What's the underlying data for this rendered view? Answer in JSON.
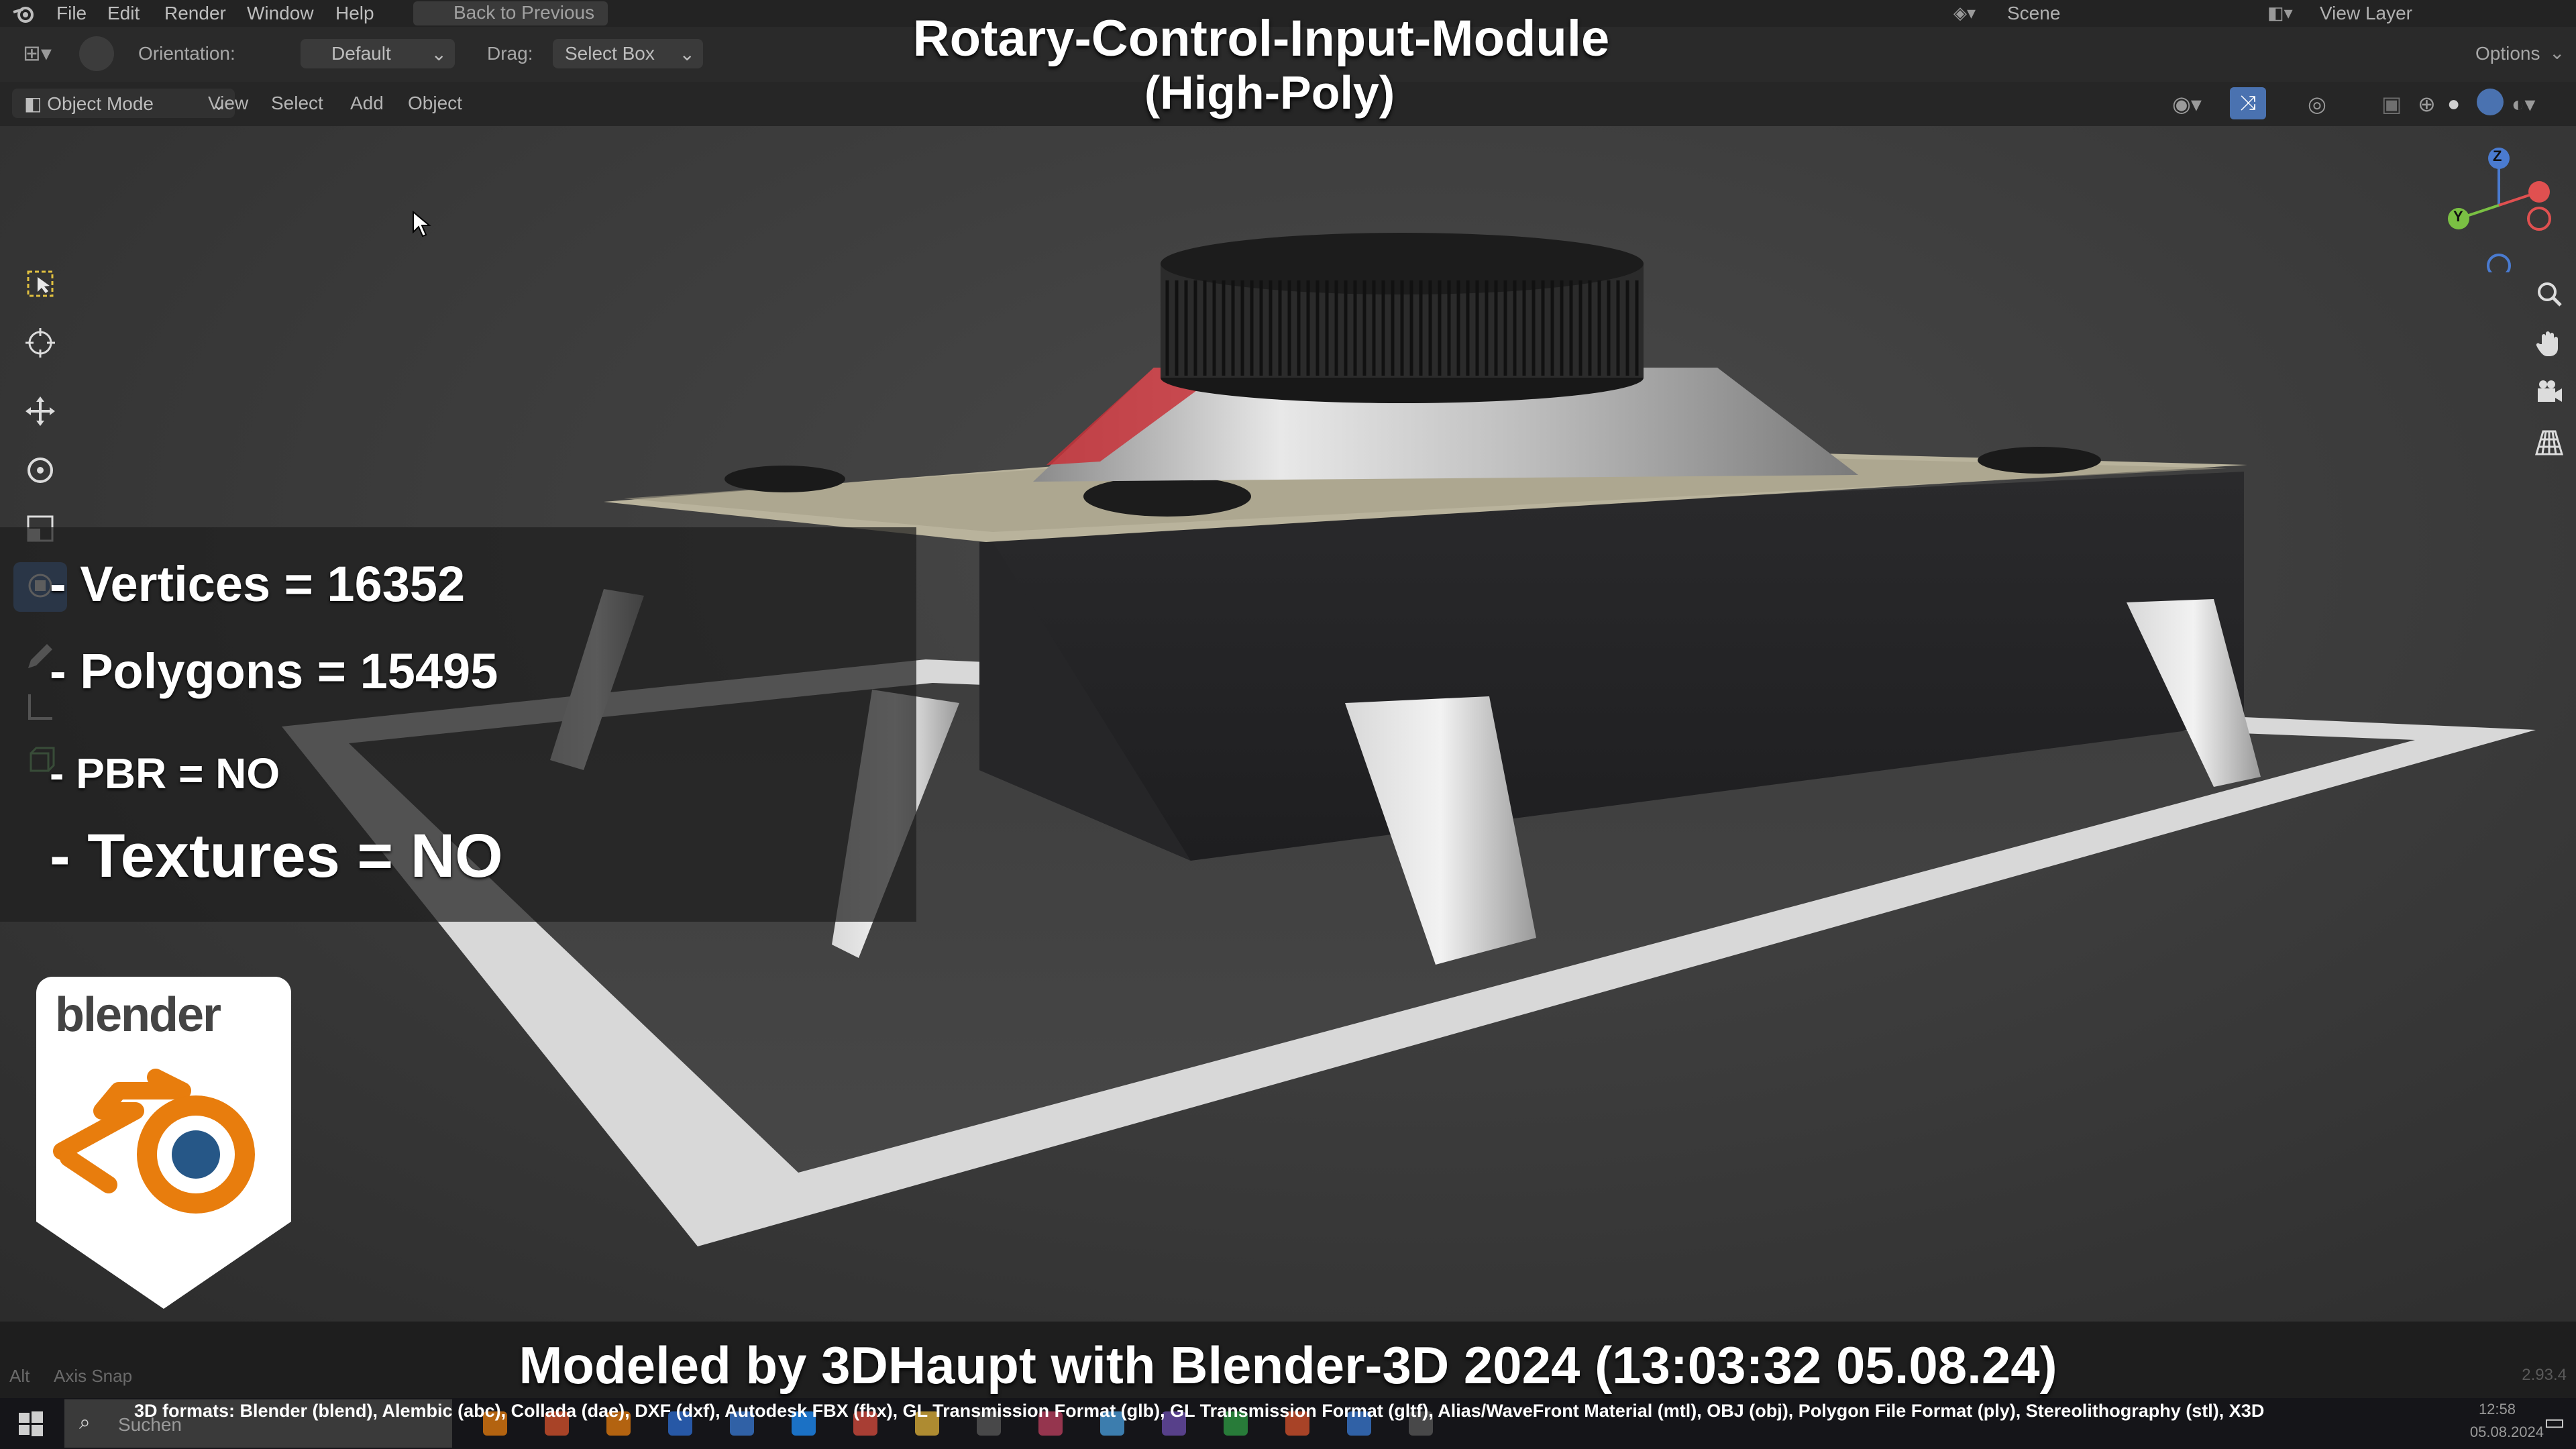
{
  "menu": {
    "items": [
      "File",
      "Edit",
      "Render",
      "Window",
      "Help"
    ],
    "back_button": "Back to Previous",
    "scene_label": "Scene",
    "view_layer_label": "View Layer"
  },
  "header": {
    "orientation_label": "Orientation:",
    "orientation_value": "Default",
    "drag_label": "Drag:",
    "drag_value": "Select Box",
    "options_label": "Options",
    "mode_label": "Object Mode",
    "menus": [
      "View",
      "Select",
      "Add",
      "Object"
    ]
  },
  "overlay": {
    "title_line1": "Rotary-Control-Input-Module",
    "title_line2": "(High-Poly)",
    "stats": [
      "- Vertices = 16352",
      "- Polygons = 15495",
      "- PBR =  NO",
      "- Textures = NO"
    ],
    "logo_text": "blender",
    "credit": "Modeled by 3DHaupt with Blender-3D 2024 (13:03:32  05.08.24)",
    "formats": "3D formats: Blender (blend), Alembic (abc), Collada (dae), DXF (dxf), Autodesk FBX (fbx), GL Transmission Format (glb), GL Transmission Format (gltf), Alias/WaveFront Material (mtl), OBJ (obj), Polygon File Format (ply), Stereolithography (stl), X3D"
  },
  "gizmo": {
    "z": "Z",
    "y": "Y"
  },
  "status": {
    "axis_snap": "Axis Snap",
    "alt_key": "Alt",
    "version": "2.93.4"
  },
  "taskbar": {
    "search_placeholder": "Suchen",
    "time": "12:58",
    "date": "05.08.2024"
  },
  "colors": {
    "active_tool": "#4a72b0",
    "blender_orange": "#e87d0d",
    "blender_blue": "#265787"
  }
}
